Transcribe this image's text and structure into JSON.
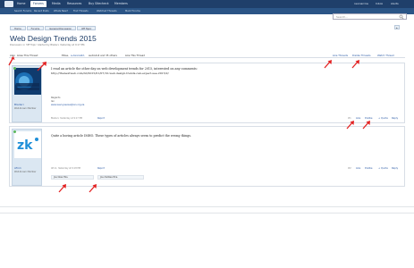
{
  "nav": {
    "tabs": [
      "Home",
      "Forums",
      "Media",
      "Resources",
      "Buy Sitecheck",
      "Members"
    ],
    "active": "Forums",
    "right_items": [
      "neonarrow",
      "Inbox",
      "Alerts"
    ],
    "subtabs": [
      "Search Forums",
      "Recent Posts",
      "Whats New?",
      "Find Threads",
      "Watched Threads",
      "Mark Forums"
    ]
  },
  "search": {
    "placeholder": "Search..."
  },
  "breadcrumb": [
    "Home",
    "Forums",
    "General Discussion",
    "Off Topic"
  ],
  "thread": {
    "title": "Web Design Trends 2015",
    "subtitle": "Discussion in 'Off Topic' started by Bladeri, Yesterday at 9:17 PM.",
    "like_bar": {
      "left_a": "Alex",
      "left_b": "Likes This Thread",
      "liked_prefix": "Ellisa,",
      "liked_link": "a-dennis62,",
      "liked_suffix": "audiodoll and 35 others",
      "liked_end": "Like This Thread",
      "like_threads": "Like Threads",
      "dislike_threads": "Dislike Threads",
      "watch_threads": "Watch Thread"
    }
  },
  "posts": [
    {
      "author": "Bladeri",
      "role": "Well-Known Member",
      "text_line1": "I read an article the other day on web development trends for 2015, interested on any comments:",
      "text_line2": "http://thenextweb.com/dd/2015/01/07/10-web-design-trends-can-expect-see-2015/2/",
      "sig_line1": "Regards",
      "sig_line2": "Ian",
      "sig_line3": "www.savvyseosa@ian.org.za",
      "meta": "Bladeri, Yesterday at 9:17 PM",
      "report": "Report",
      "actions": {
        "count": "#1",
        "like": "Like",
        "dislike": "Dislike",
        "quote": "+ Quote",
        "reply": "Reply"
      }
    },
    {
      "author": "Afro1",
      "role": "Well-Known Member",
      "text_line1": "Quite a boring article IMHO. These types of articles always seem to predict the wrong things.",
      "meta": "Afro1, Yesterday at 9:18 PM",
      "report": "Report",
      "actions": {
        "count": "#2",
        "like": "Like",
        "dislike": "Dislike",
        "quote": "+ Quote",
        "reply": "Reply"
      },
      "liked_strip": "Joe likes this.",
      "disliked_strip": "Joe dislikes this."
    }
  ],
  "colors": {
    "nav_bg": "#1f3f6a",
    "subnav_bg": "#2b5586",
    "title": "#1b3b66",
    "link": "#2b5aa6",
    "annotation_arrow": "#e32222",
    "online_dot": "#5cb85c"
  }
}
